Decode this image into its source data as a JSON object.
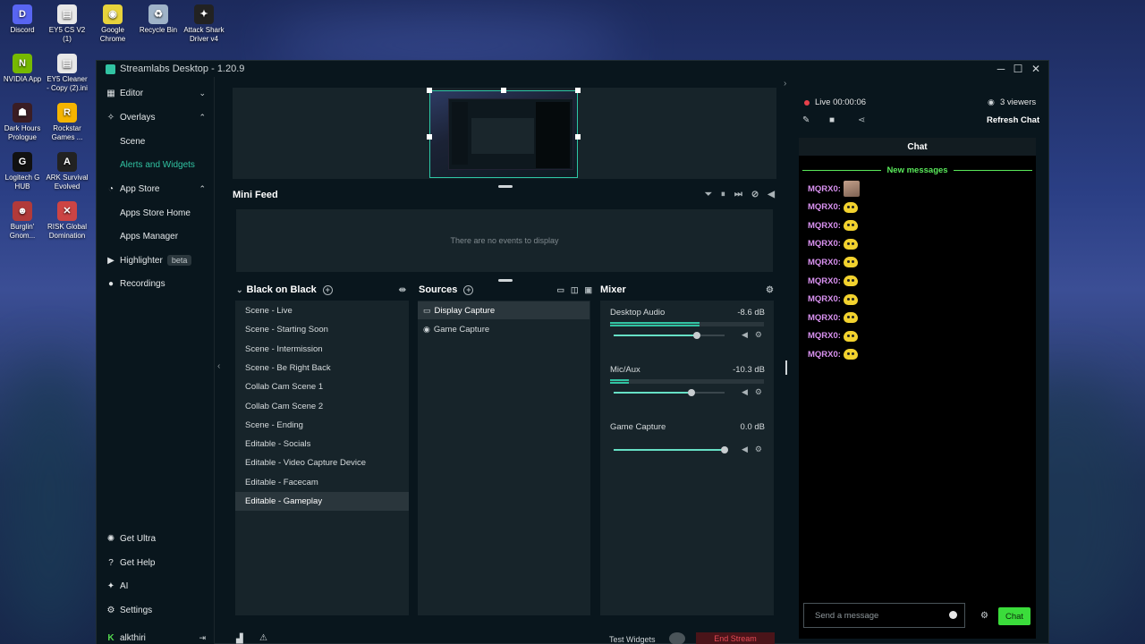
{
  "desktop": {
    "icons": [
      {
        "label": "Discord",
        "color": "#5865f2",
        "glyph": "D"
      },
      {
        "label": "EY5 CS V2 (1)",
        "color": "#e8e8e8",
        "glyph": "▤"
      },
      {
        "label": "Google Chrome",
        "color": "#e7d33c",
        "glyph": "◉"
      },
      {
        "label": "Recycle Bin",
        "color": "#9fb3c8",
        "glyph": "♻"
      },
      {
        "label": "Attack Shark Driver v4",
        "color": "#222",
        "glyph": "✦"
      },
      {
        "label": "NVIDIA App",
        "color": "#76b900",
        "glyph": "N"
      },
      {
        "label": "EY5 Cleaner - Copy (2).ini",
        "color": "#e8e8e8",
        "glyph": "▤"
      },
      {
        "label": "Dark Hours Prologue",
        "color": "#3a1d24",
        "glyph": "☗"
      },
      {
        "label": "Rockstar Games ...",
        "color": "#f5b400",
        "glyph": "R"
      },
      {
        "label": "Logitech G HUB",
        "color": "#111",
        "glyph": "G"
      },
      {
        "label": "ARK Survival Evolved",
        "color": "#222",
        "glyph": "A"
      },
      {
        "label": "Burglin' Gnom...",
        "color": "#b23a3a",
        "glyph": "☻"
      },
      {
        "label": "RISK Global Domination",
        "color": "#c44",
        "glyph": "✕"
      }
    ]
  },
  "window": {
    "title": "Streamlabs Desktop - 1.20.9",
    "minimize_icon": "─",
    "maximize_icon": "☐",
    "close_icon": "✕"
  },
  "sidebar": {
    "editor": "Editor",
    "overlays": "Overlays",
    "scene": "Scene",
    "alerts_widgets": "Alerts and Widgets",
    "app_store": "App Store",
    "apps_store_home": "Apps Store Home",
    "apps_manager": "Apps Manager",
    "highlighter": "Highlighter",
    "highlighter_badge": "beta",
    "recordings": "Recordings",
    "get_ultra": "Get Ultra",
    "get_help": "Get Help",
    "ai": "AI",
    "settings": "Settings",
    "user": "alkthiri"
  },
  "mini_feed": {
    "title": "Mini Feed",
    "empty": "There are no events to display"
  },
  "scenes": {
    "title": "Black on Black",
    "items": [
      "Scene - Live",
      "Scene - Starting Soon",
      "Scene - Intermission",
      "Scene - Be Right Back",
      "Collab Cam Scene 1",
      "Collab Cam Scene 2",
      "Scene - Ending",
      "Editable - Socials",
      "Editable - Video Capture Device",
      "Editable - Facecam",
      "Editable - Gameplay"
    ],
    "selected_index": 10
  },
  "sources": {
    "title": "Sources",
    "items": [
      "Display Capture",
      "Game Capture"
    ]
  },
  "mixer": {
    "title": "Mixer",
    "channels": [
      {
        "name": "Desktop Audio",
        "db": "-8.6 dB",
        "level": 0.58,
        "volume": 0.75
      },
      {
        "name": "Mic/Aux",
        "db": "-10.3 dB",
        "level": 0.12,
        "volume": 0.7
      },
      {
        "name": "Game Capture",
        "db": "0.0 dB",
        "level": 0.0,
        "volume": 1.0
      }
    ]
  },
  "bottom": {
    "test_widgets": "Test Widgets",
    "end_stream": "End Stream"
  },
  "chat_pane": {
    "live": "Live 00:00:06",
    "viewers": "3 viewers",
    "refresh": "Refresh Chat",
    "header": "Chat",
    "new_messages": "New messages",
    "messages": [
      "MQRX0:",
      "MQRX0:",
      "MQRX0:",
      "MQRX0:",
      "MQRX0:",
      "MQRX0:",
      "MQRX0:",
      "MQRX0:",
      "MQRX0:",
      "MQRX0:"
    ],
    "input_placeholder": "Send a message",
    "send_label": "Chat"
  },
  "colors": {
    "accent": "#31c3a2",
    "chat_user": "#d891ef",
    "new_messages": "#59e85a",
    "live_dot": "#e8414b"
  }
}
